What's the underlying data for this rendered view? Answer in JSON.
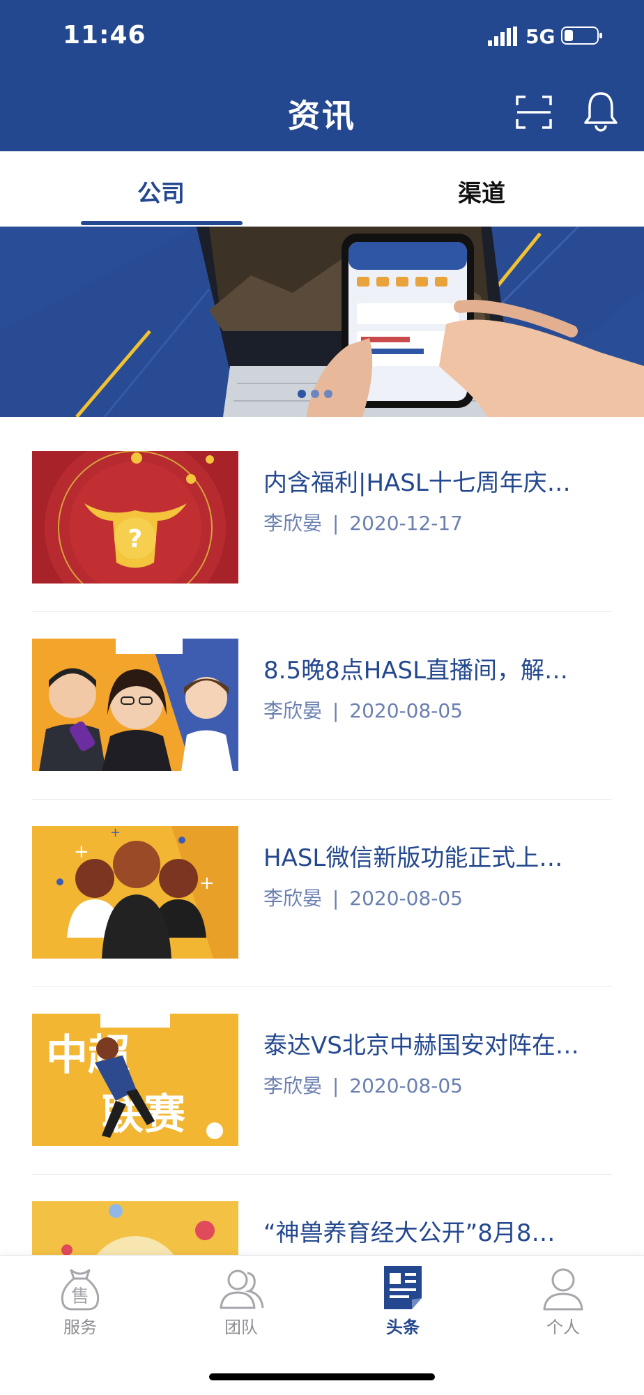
{
  "status_bar": {
    "time": "11:46",
    "network": "5G"
  },
  "header": {
    "title": "资讯"
  },
  "tabs": [
    {
      "label": "公司",
      "active": true
    },
    {
      "label": "渠道",
      "active": false
    }
  ],
  "articles": [
    {
      "title": "内含福利|HASL十七周年庆…",
      "author": "李欣晏",
      "sep": "|",
      "date": "2020-12-17"
    },
    {
      "title": "8.5晚8点HASL直播间，解…",
      "author": "李欣晏",
      "sep": "|",
      "date": "2020-08-05"
    },
    {
      "title": "HASL微信新版功能正式上…",
      "author": "李欣晏",
      "sep": "|",
      "date": "2020-08-05"
    },
    {
      "title": "泰达VS北京中赫国安对阵在…",
      "author": "李欣晏",
      "sep": "|",
      "date": "2020-08-05"
    },
    {
      "title": "“神兽养育经大公开”8月8…"
    }
  ],
  "thumbs": {
    "sports_line1": "中超",
    "sports_line2": "联赛"
  },
  "bottom_nav": [
    {
      "label": "服务",
      "icon": "moneybag-icon",
      "glyph": "售",
      "active": false
    },
    {
      "label": "团队",
      "icon": "team-icon",
      "active": false
    },
    {
      "label": "头条",
      "icon": "news-icon",
      "active": true
    },
    {
      "label": "个人",
      "icon": "person-icon",
      "active": false
    }
  ],
  "colors": {
    "brand": "#24488f",
    "meta": "#6a7fb0",
    "inactive": "#8e8e93"
  }
}
